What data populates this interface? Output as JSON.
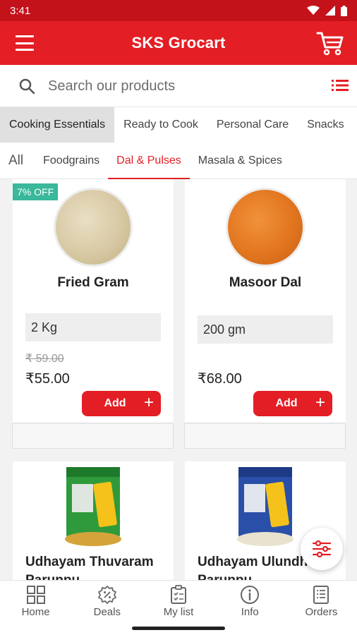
{
  "status_bar": {
    "time": "3:41"
  },
  "app_bar": {
    "title": "SKS Grocart"
  },
  "search": {
    "placeholder": "Search our products"
  },
  "categories": [
    {
      "label": "Cooking Essentials",
      "active": true
    },
    {
      "label": "Ready to Cook",
      "active": false
    },
    {
      "label": "Personal Care",
      "active": false
    },
    {
      "label": "Snacks",
      "active": false
    }
  ],
  "subcategories": [
    {
      "label": "All",
      "active": false
    },
    {
      "label": "Foodgrains",
      "active": false
    },
    {
      "label": "Dal & Pulses",
      "active": true
    },
    {
      "label": "Masala & Spices",
      "active": false
    }
  ],
  "products": [
    {
      "name": "Fried Gram",
      "badge": "7% OFF",
      "variant": "2 Kg",
      "old_price": "₹ 59.00",
      "price": "₹55.00",
      "add_label": "Add",
      "plus": "+",
      "image_color": "#d8c9a4"
    },
    {
      "name": "Masoor Dal",
      "variant": "200 gm",
      "price": "₹68.00",
      "add_label": "Add",
      "plus": "+",
      "image_color": "#e2761f"
    },
    {
      "name_line1": "Udhayam Thuvaram",
      "name_line2": "Paruppu",
      "package_color": "#2f9a3b"
    },
    {
      "name_line1": "Udhayam Ulundhu",
      "name_line2": "Paruppu",
      "package_color": "#2a4fa8"
    }
  ],
  "bottom_nav": [
    {
      "label": "Home",
      "icon": "home-grid-icon"
    },
    {
      "label": "Deals",
      "icon": "deals-badge-icon"
    },
    {
      "label": "My list",
      "icon": "my-list-icon"
    },
    {
      "label": "Info",
      "icon": "info-icon"
    },
    {
      "label": "Orders",
      "icon": "orders-icon"
    }
  ],
  "colors": {
    "brand": "#e31e24",
    "status_bar": "#c4121a",
    "badge": "#39b89a"
  }
}
